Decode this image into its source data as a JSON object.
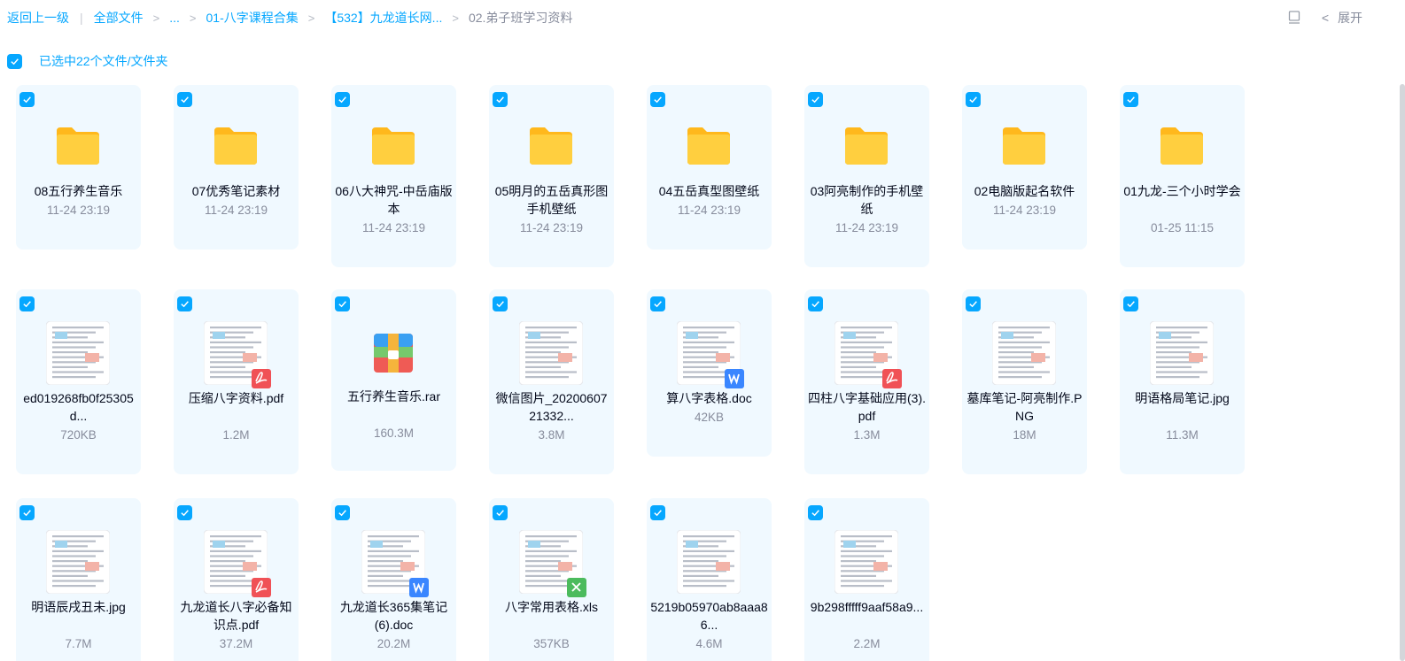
{
  "breadcrumb": {
    "back": "返回上一级",
    "all_files": "全部文件",
    "ellipsis": "...",
    "level1": "01-八字课程合集",
    "level2": "【532】九龙道长网...",
    "current": "02.弟子班学习资料"
  },
  "toolbar": {
    "expand_label": "展开"
  },
  "selection": {
    "summary": "已选中22个文件/文件夹"
  },
  "colors": {
    "accent": "#06a7ff",
    "card_bg": "#f0f9ff",
    "folder": "#ffc93c"
  },
  "files": [
    {
      "name": "08五行养生音乐",
      "meta": "11-24 23:19",
      "type": "folder"
    },
    {
      "name": "07优秀笔记素材",
      "meta": "11-24 23:19",
      "type": "folder"
    },
    {
      "name": "06八大神咒-中岳庙版本",
      "meta": "11-24 23:19",
      "type": "folder"
    },
    {
      "name": "05明月的五岳真形图手机壁纸",
      "meta": "11-24 23:19",
      "type": "folder"
    },
    {
      "name": "04五岳真型图壁纸",
      "meta": "11-24 23:19",
      "type": "folder"
    },
    {
      "name": "03阿亮制作的手机壁纸",
      "meta": "11-24 23:19",
      "type": "folder"
    },
    {
      "name": "02电脑版起名软件",
      "meta": "11-24 23:19",
      "type": "folder"
    },
    {
      "name": "01九龙-三个小时学会",
      "meta": "01-25 11:15",
      "type": "folder"
    },
    {
      "name": "ed019268fb0f25305d...",
      "meta": "720KB",
      "type": "image",
      "badge": ""
    },
    {
      "name": "压缩八字资料.pdf",
      "meta": "1.2M",
      "type": "image",
      "badge": "pdf"
    },
    {
      "name": "五行养生音乐.rar",
      "meta": "160.3M",
      "type": "rar"
    },
    {
      "name": "微信图片_2020060721332...",
      "meta": "3.8M",
      "type": "image",
      "badge": ""
    },
    {
      "name": "算八字表格.doc",
      "meta": "42KB",
      "type": "image",
      "badge": "doc"
    },
    {
      "name": "四柱八字基础应用(3).pdf",
      "meta": "1.3M",
      "type": "image",
      "badge": "pdf"
    },
    {
      "name": "墓库笔记-阿亮制作.PNG",
      "meta": "18M",
      "type": "image",
      "badge": ""
    },
    {
      "name": "明语格局笔记.jpg",
      "meta": "11.3M",
      "type": "image",
      "badge": ""
    },
    {
      "name": "明语辰戌丑未.jpg",
      "meta": "7.7M",
      "type": "image",
      "badge": ""
    },
    {
      "name": "九龙道长八字必备知识点.pdf",
      "meta": "37.2M",
      "type": "image",
      "badge": "pdf"
    },
    {
      "name": "九龙道长365集笔记(6).doc",
      "meta": "20.2M",
      "type": "image",
      "badge": "doc"
    },
    {
      "name": "八字常用表格.xls",
      "meta": "357KB",
      "type": "image",
      "badge": "xls"
    },
    {
      "name": "5219b05970ab8aaa86...",
      "meta": "4.6M",
      "type": "image",
      "badge": ""
    },
    {
      "name": "9b298fffff9aaf58a9...",
      "meta": "2.2M",
      "type": "image",
      "badge": ""
    }
  ]
}
